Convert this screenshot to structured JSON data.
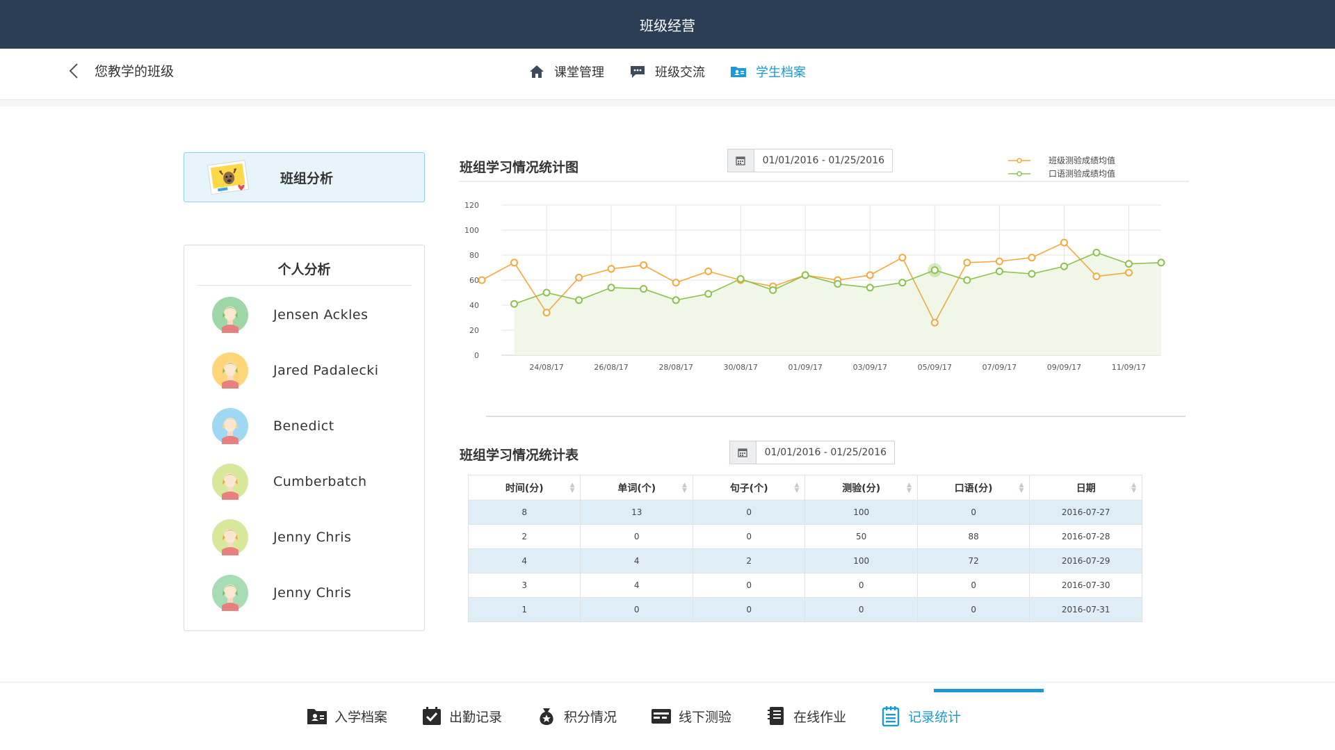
{
  "header": {
    "title": "班级经营"
  },
  "subnav": {
    "back_label": "您教学的班级",
    "tabs": [
      {
        "label": "课堂管理",
        "icon": "home-icon",
        "active": false
      },
      {
        "label": "班级交流",
        "icon": "chat-icon",
        "active": false
      },
      {
        "label": "学生档案",
        "icon": "profile-folder-icon",
        "active": true
      }
    ]
  },
  "sidebar": {
    "group_card": {
      "label": "班组分析",
      "icon": "deer-picture-icon"
    },
    "personal": {
      "title": "个人分析",
      "students": [
        {
          "name": "Jensen Ackles",
          "avatar_bg": "#9fd6a8",
          "hair": "#7fc25a"
        },
        {
          "name": "Jared Padalecki",
          "avatar_bg": "#ffd57a",
          "hair": "#8cc24a"
        },
        {
          "name": "Benedict",
          "avatar_bg": "#9fd8f2",
          "hair": "#ffd57a"
        },
        {
          "name": "Cumberbatch",
          "avatar_bg": "#d8e89a",
          "hair": "#f5a64a"
        },
        {
          "name": "Jenny Chris",
          "avatar_bg": "#d8e89a",
          "hair": "#f5a64a"
        },
        {
          "name": "Jenny Chris",
          "avatar_bg": "#a8dcb4",
          "hair": "#7fc25a"
        }
      ]
    }
  },
  "chart_section": {
    "title": "班组学习情况统计图",
    "date_range": "01/01/2016 - 01/25/2016"
  },
  "chart_data": {
    "type": "line",
    "title": "",
    "xlabel": "",
    "ylabel": "",
    "ylim": [
      0,
      120
    ],
    "yticks": [
      0,
      20,
      40,
      60,
      80,
      100,
      120
    ],
    "x_tick_labels": [
      "24/08/17",
      "26/08/17",
      "28/08/17",
      "30/08/17",
      "01/09/17",
      "03/09/17",
      "05/09/17",
      "07/09/17",
      "09/09/17",
      "11/09/17"
    ],
    "grid": true,
    "legend_position": "top-right",
    "series": [
      {
        "name": "班级测验成绩均值",
        "color": "#f5a93a",
        "values": [
          60,
          74,
          34,
          62,
          69,
          72,
          58,
          67,
          60,
          55,
          64,
          60,
          64,
          78,
          26,
          74,
          75,
          78,
          90,
          63,
          66,
          null
        ]
      },
      {
        "name": "口语测验成绩均值",
        "color": "#8bc34a",
        "values": [
          null,
          41,
          50,
          44,
          54,
          53,
          44,
          49,
          61,
          52,
          64,
          57,
          54,
          58,
          68,
          60,
          67,
          65,
          71,
          82,
          73,
          74
        ]
      }
    ]
  },
  "table_section": {
    "title": "班组学习情况统计表",
    "date_range": "01/01/2016 - 01/25/2016",
    "columns": [
      "时间(分)",
      "单词(个)",
      "句子(个)",
      "测验(分)",
      "口语(分)",
      "日期"
    ],
    "rows": [
      [
        "8",
        "13",
        "0",
        "100",
        "0",
        "2016-07-27"
      ],
      [
        "2",
        "0",
        "0",
        "50",
        "88",
        "2016-07-28"
      ],
      [
        "4",
        "4",
        "2",
        "100",
        "72",
        "2016-07-29"
      ],
      [
        "3",
        "4",
        "0",
        "0",
        "0",
        "2016-07-30"
      ],
      [
        "1",
        "0",
        "0",
        "0",
        "0",
        "2016-07-31"
      ]
    ]
  },
  "bottom_nav": {
    "tabs": [
      {
        "label": "入学档案",
        "icon": "enrollment-folder-icon",
        "active": false
      },
      {
        "label": "出勤记录",
        "icon": "attendance-check-icon",
        "active": false
      },
      {
        "label": "积分情况",
        "icon": "points-bag-icon",
        "active": false
      },
      {
        "label": "线下测验",
        "icon": "offline-test-icon",
        "active": false
      },
      {
        "label": "在线作业",
        "icon": "online-homework-icon",
        "active": false
      },
      {
        "label": "记录统计",
        "icon": "record-stats-icon",
        "active": true
      }
    ]
  },
  "colors": {
    "header_bg": "#2c3e55",
    "accent": "#1a9ad6",
    "orange": "#f5a93a",
    "green": "#8bc34a",
    "row_highlight": "#deedf6"
  }
}
